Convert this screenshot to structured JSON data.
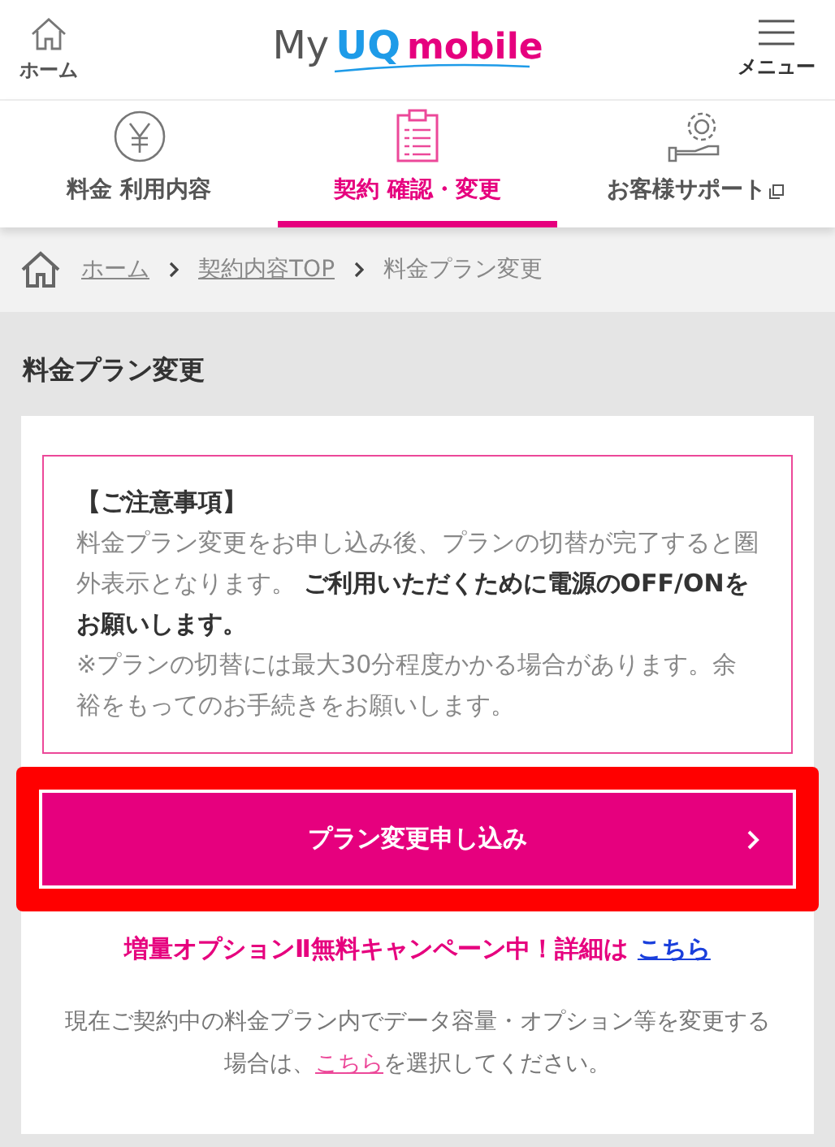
{
  "header": {
    "home_label": "ホーム",
    "logo": {
      "my": "My",
      "uq": "UQ",
      "mobile": "mobile"
    },
    "menu_label": "メニュー"
  },
  "tabs": [
    {
      "label": "料金 利用内容",
      "selected": false,
      "external": false
    },
    {
      "label": "契約 確認・変更",
      "selected": true,
      "external": false
    },
    {
      "label": "お客様サポート",
      "selected": false,
      "external": true
    }
  ],
  "breadcrumb": [
    {
      "label": "ホーム",
      "link": true
    },
    {
      "label": "契約内容TOP",
      "link": true
    },
    {
      "label": "料金プラン変更",
      "link": false
    }
  ],
  "page_title": "料金プラン変更",
  "notice": {
    "heading": "【ご注意事項】",
    "body": "料金プラン変更をお申し込み後、プランの切替が完了すると圏外表示となります。 **ご利用いただくために電源のOFF/ONをお願いします。**",
    "note": "※プランの切替には最大30分程度かかる場合があります。余裕をもってのお手続きをお願いします。"
  },
  "apply_button": {
    "label": "プラン変更申し込み",
    "highlighted": true
  },
  "campaign": {
    "text": "増量オプションⅡ無料キャンペーン中！詳細は",
    "link": "こちら"
  },
  "other_change": {
    "before": "現在ご契約中の料金プラン内でデータ容量・オプション等を変更する場合は、",
    "link": "こちら",
    "after": "を選択してください。"
  }
}
